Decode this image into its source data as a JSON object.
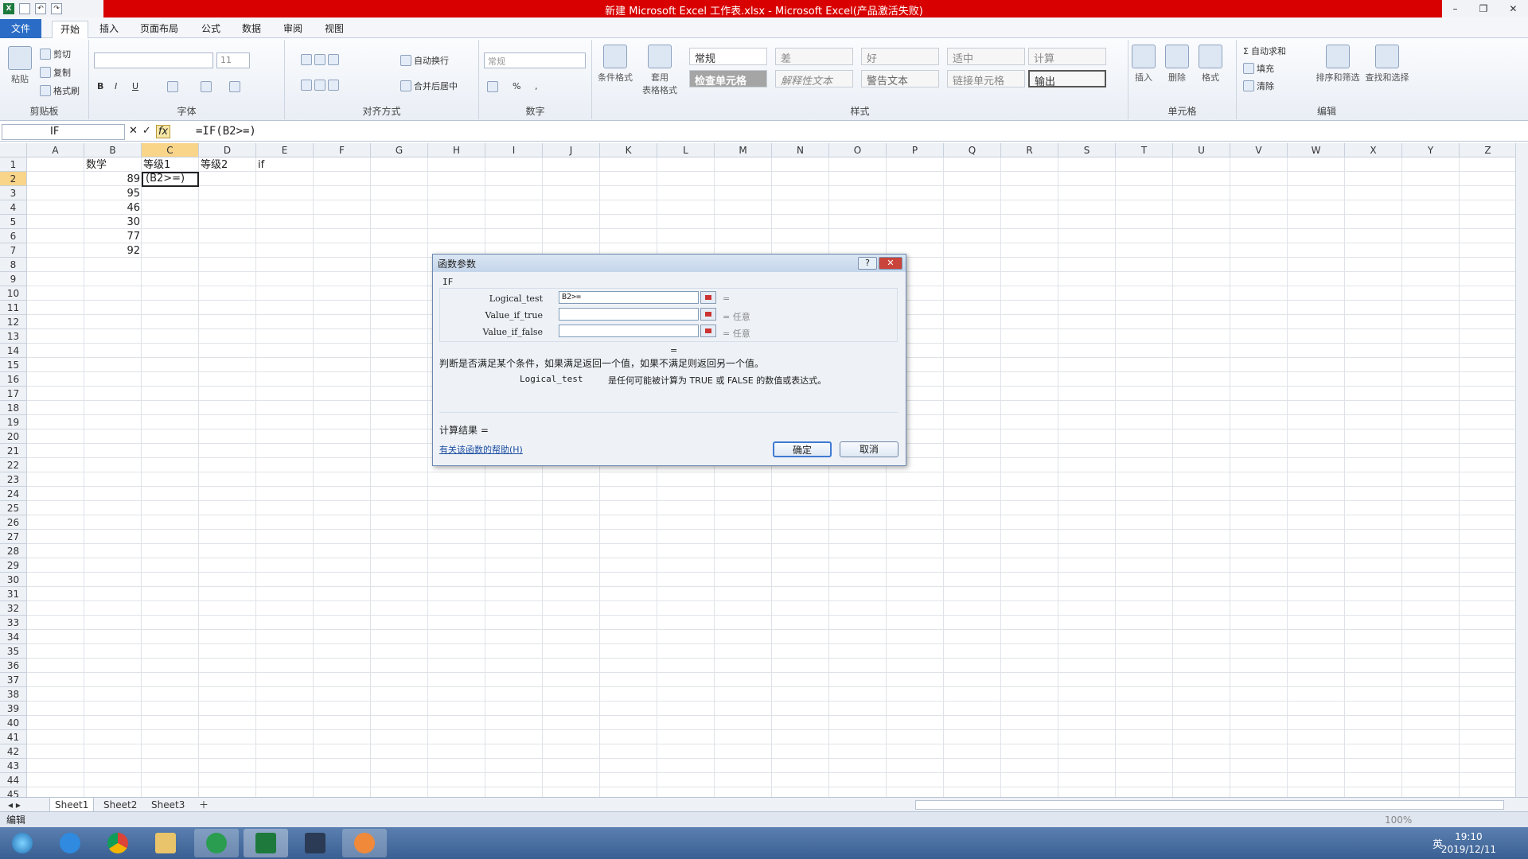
{
  "window": {
    "title": "新建 Microsoft Excel 工作表.xlsx - Microsoft Excel(产品激活失败)"
  },
  "tabs": [
    "文件",
    "开始",
    "插入",
    "页面布局",
    "公式",
    "数据",
    "审阅",
    "视图"
  ],
  "ribbon": {
    "clipboard": {
      "paste": "粘贴",
      "cut": "剪切",
      "copy": "复制",
      "format_painter": "格式刷",
      "label": "剪贴板"
    },
    "font": {
      "font_name": "",
      "font_size": "11",
      "label": "字体",
      "bold": "B",
      "italic": "I",
      "underline": "U"
    },
    "alignment": {
      "wrap": "自动换行",
      "merge": "合并后居中",
      "label": "对齐方式"
    },
    "number": {
      "format": "常规",
      "percent": "%",
      "comma": ",",
      "label": "数字"
    },
    "styles": {
      "conditional": "条件格式",
      "table": "套用\n表格格式",
      "cells": [
        "常规",
        "差",
        "好",
        "适中",
        "计算",
        "检查单元格",
        "解释性文本",
        "警告文本",
        "链接单元格",
        "输出"
      ],
      "label": "样式"
    },
    "cells_group": {
      "insert": "插入",
      "delete": "删除",
      "format": "格式",
      "label": "单元格"
    },
    "editing": {
      "autosum": "自动求和",
      "fill": "填充",
      "clear": "清除",
      "sort": "排序和筛选",
      "find": "查找和选择",
      "label": "编辑"
    }
  },
  "formula_bar": {
    "name_box": "IF",
    "formula": "=IF(B2>=)"
  },
  "columns": [
    "A",
    "B",
    "C",
    "D",
    "E",
    "F",
    "G",
    "H",
    "I",
    "J",
    "K",
    "L",
    "M",
    "N",
    "O",
    "P",
    "Q",
    "R",
    "S",
    "T",
    "U",
    "V",
    "W",
    "X",
    "Y",
    "Z"
  ],
  "cells": {
    "B1": "数学",
    "C1": "等级1",
    "D1": "等级2",
    "E1": "if",
    "B2": "89",
    "C2": "(B2>=)",
    "B3": "95",
    "B4": "46",
    "B5": "30",
    "B6": "77",
    "B7": "92"
  },
  "sheets": [
    "Sheet1",
    "Sheet2",
    "Sheet3"
  ],
  "status": {
    "mode": "编辑",
    "zoom": "100%"
  },
  "dialog": {
    "title": "函数参数",
    "function": "IF",
    "args": [
      {
        "name": "Logical_test",
        "value": "B2>=",
        "result": "="
      },
      {
        "name": "Value_if_true",
        "value": "",
        "result": "= 任意"
      },
      {
        "name": "Value_if_false",
        "value": "",
        "result": "= 任意"
      }
    ],
    "eq": "=",
    "description": "判断是否满足某个条件，如果满足返回一个值，如果不满足则返回另一个值。",
    "arg_desc_name": "Logical_test",
    "arg_desc_text": "是任何可能被计算为 TRUE 或 FALSE 的数值或表达式。",
    "result": "计算结果 =",
    "help_link": "有关该函数的帮助(H)",
    "ok": "确定",
    "cancel": "取消"
  },
  "taskbar": {
    "time": "19:10",
    "date": "2019/12/11",
    "ime": "英"
  }
}
